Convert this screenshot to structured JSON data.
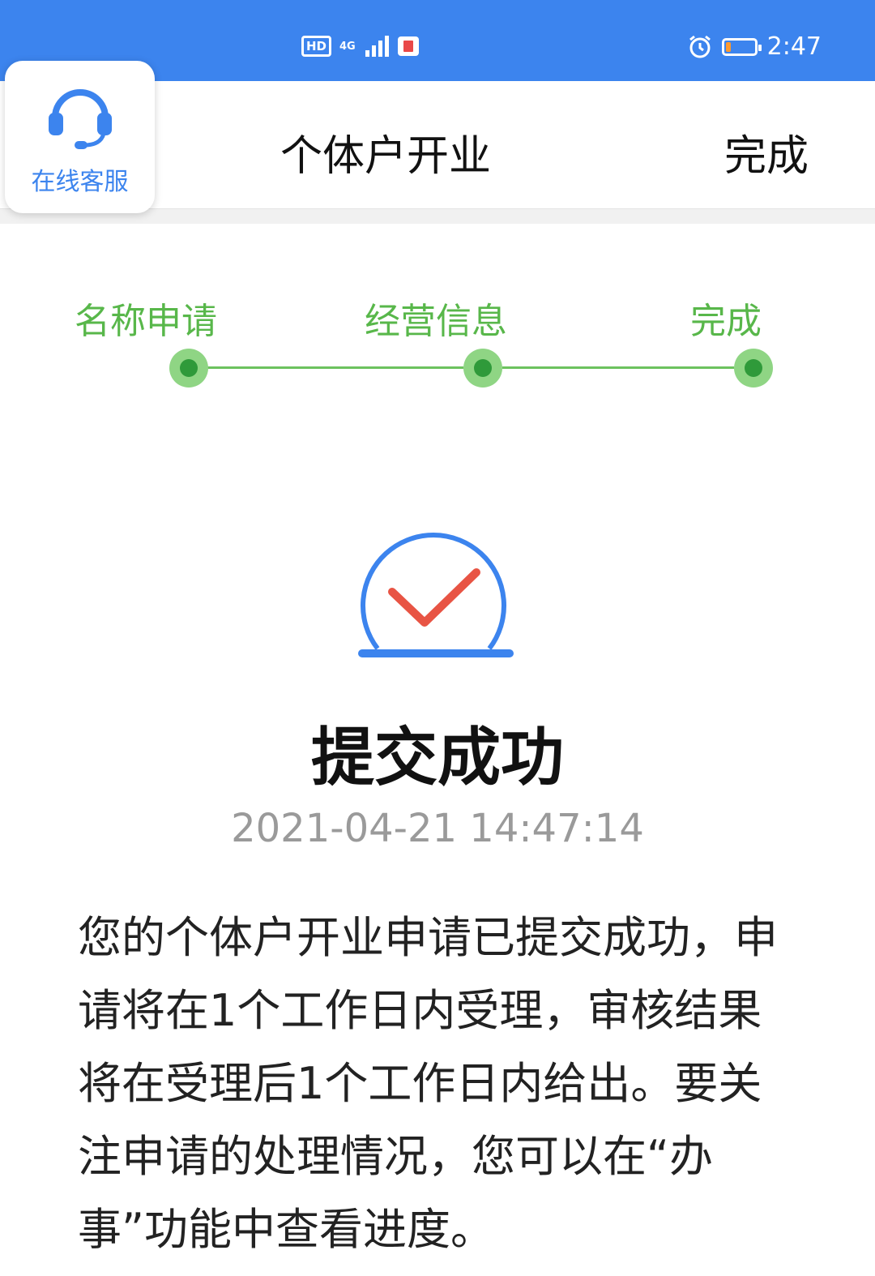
{
  "status_bar": {
    "hd": "HD",
    "network_type": "4G",
    "time": "2:47",
    "battery_color": "#ff9a2e"
  },
  "header": {
    "title": "个体户开业",
    "done_label": "完成"
  },
  "service": {
    "label": "在线客服",
    "icon": "headset-icon"
  },
  "steps": [
    {
      "label": "名称申请",
      "status": "complete"
    },
    {
      "label": "经营信息",
      "status": "complete"
    },
    {
      "label": "完成",
      "status": "complete"
    }
  ],
  "result": {
    "icon": "success-check-icon",
    "title": "提交成功",
    "timestamp": "2021-04-21 14:47:14",
    "message": "您的个体户开业申请已提交成功，申请将在1个工作日内受理，审核结果将在受理后1个工作日内给出。要关注申请的处理情况，您可以在“办事”功能中查看进度。"
  },
  "colors": {
    "status_bar": "#3c84ee",
    "step_green": "#58b74a",
    "check_red": "#e85444",
    "circle_blue": "#3c84ee"
  }
}
